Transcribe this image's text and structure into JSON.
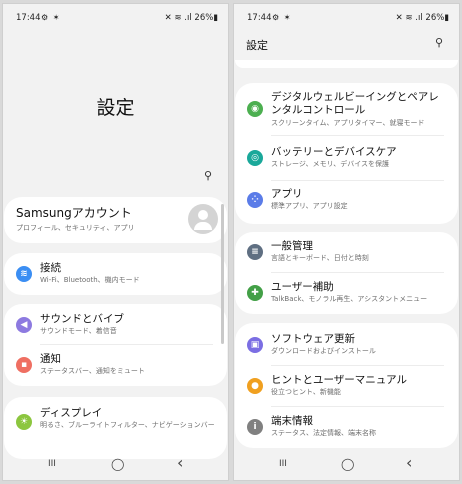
{
  "status_bar": {
    "time": "17:44",
    "left_icons": "⚙ ✶",
    "right": "✕ ≋ .ıl 26%▮"
  },
  "left": {
    "title": "設定",
    "account": {
      "title": "Samsungアカウント",
      "sub": "プロフィール、セキュリティ、アプリ"
    },
    "items": [
      {
        "title": "接続",
        "sub": "Wi-Fi、Bluetooth、機内モード",
        "color": "#3b8ef3",
        "icon": "≋"
      },
      {
        "title": "サウンドとバイブ",
        "sub": "サウンドモード、着信音",
        "color": "#8d7ae0",
        "icon": "◀"
      },
      {
        "title": "通知",
        "sub": "ステータスバー、通知をミュート",
        "color": "#ef6f62",
        "icon": "▪"
      },
      {
        "title": "ディスプレイ",
        "sub": "明るさ、ブルーライトフィルター、ナビゲーションバー",
        "color": "#8cc63f",
        "icon": "☀"
      }
    ]
  },
  "right": {
    "header_title": "設定",
    "items": [
      {
        "title": "デジタルウェルビーイングとペアレンタルコントロール",
        "sub": "スクリーンタイム、アプリタイマー、就寝モード",
        "color": "#4caf50",
        "icon": "◉"
      },
      {
        "title": "バッテリーとデバイスケア",
        "sub": "ストレージ、メモリ、デバイスを保護",
        "color": "#1aa89a",
        "icon": "◎"
      },
      {
        "title": "アプリ",
        "sub": "標準アプリ、アプリ設定",
        "color": "#5b7ce8",
        "icon": "⁘"
      },
      {
        "title": "一般管理",
        "sub": "言語とキーボード、日付と時刻",
        "color": "#5f6f82",
        "icon": "≡"
      },
      {
        "title": "ユーザー補助",
        "sub": "TalkBack、モノラル再生、アシスタントメニュー",
        "color": "#43a047",
        "icon": "✚"
      },
      {
        "title": "ソフトウェア更新",
        "sub": "ダウンロードおよびインストール",
        "color": "#7b6ee3",
        "icon": "▣"
      },
      {
        "title": "ヒントとユーザーマニュアル",
        "sub": "役立つヒント、新機能",
        "color": "#f0a020",
        "icon": "●"
      },
      {
        "title": "端末情報",
        "sub": "ステータス、法定情報、端末名称",
        "color": "#808080",
        "icon": "i"
      }
    ]
  },
  "nav": {
    "recents": "III",
    "home": "◯",
    "back": "‹"
  },
  "search_icon": "⚲"
}
